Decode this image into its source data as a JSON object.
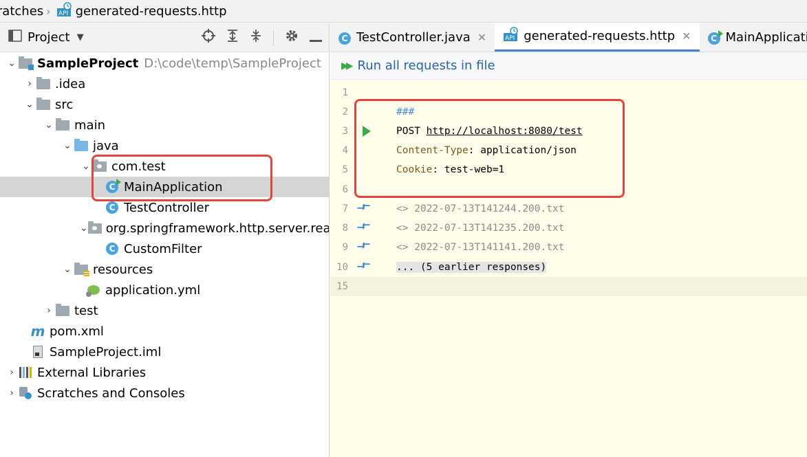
{
  "breadcrumb": {
    "items": [
      "cratches",
      "generated-requests.http"
    ]
  },
  "project_panel": {
    "title": "Project",
    "tree": [
      {
        "label": "SampleProject",
        "path": "D:\\code\\temp\\SampleProject"
      },
      {
        "label": ".idea"
      },
      {
        "label": "src"
      },
      {
        "label": "main"
      },
      {
        "label": "java"
      },
      {
        "label": "com.test"
      },
      {
        "label": "MainApplication"
      },
      {
        "label": "TestController"
      },
      {
        "label": "org.springframework.http.server.reactive"
      },
      {
        "label": "CustomFilter"
      },
      {
        "label": "resources"
      },
      {
        "label": "application.yml"
      },
      {
        "label": "test"
      },
      {
        "label": "pom.xml"
      },
      {
        "label": "SampleProject.iml"
      },
      {
        "label": "External Libraries"
      },
      {
        "label": "Scratches and Consoles"
      }
    ]
  },
  "tabs": [
    {
      "label": "TestController.java"
    },
    {
      "label": "generated-requests.http"
    },
    {
      "label": "MainApplication"
    }
  ],
  "runbar": {
    "label": "Run all requests in file"
  },
  "editor": {
    "line_numbers": [
      "1",
      "2",
      "3",
      "4",
      "5",
      "6",
      "7",
      "8",
      "9",
      "10",
      "15"
    ],
    "comment": "###",
    "method": "POST",
    "url": "http://localhost:8080/test",
    "header1_name": "Content-Type",
    "header1_value": ": application/json",
    "header2_name": "Cookie",
    "header2_value": ": test-web=1",
    "responses": [
      "<> 2022-07-13T141244.200.txt",
      "<> 2022-07-13T141235.200.txt",
      "<> 2022-07-13T141141.200.txt"
    ],
    "earlier": "... (5 earlier responses)"
  },
  "colors": {
    "highlight": "#e8423e",
    "accent": "#4083c9",
    "run_green": "#3fa64a",
    "editor_bg": "#fefde9"
  }
}
